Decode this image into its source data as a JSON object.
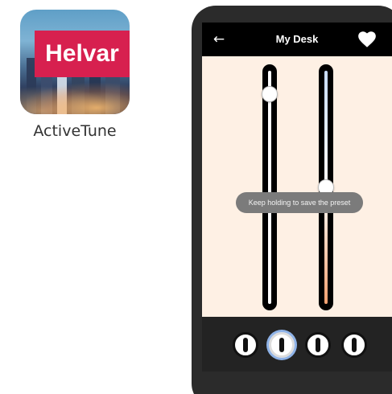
{
  "app": {
    "logo_text": "Helvar",
    "name": "ActiveTune"
  },
  "header": {
    "back_icon": "←",
    "title": "My Desk",
    "favorite_icon": "heart-icon"
  },
  "sliders": [
    {
      "name": "brightness",
      "level": 0.93,
      "fill_color": "#ffffff",
      "track_color": "#000000"
    },
    {
      "name": "color-temperature",
      "level": 0.5,
      "fill_gradient": [
        "#c8dcff",
        "#ffffff",
        "#f0a070"
      ]
    }
  ],
  "toast": {
    "text": "Keep holding to save the preset"
  },
  "presets": [
    {
      "name": "preset-1",
      "selected": false
    },
    {
      "name": "preset-2",
      "selected": true
    },
    {
      "name": "preset-3",
      "selected": false
    },
    {
      "name": "preset-4",
      "selected": false
    }
  ],
  "colors": {
    "brand": "#d7204f",
    "screen_bg": "#fef0e4",
    "topbar_bg": "#000000",
    "toast_bg": "#7b7b7b",
    "bottombar_bg": "#232323",
    "selected_ring": "#8fb3e8"
  }
}
